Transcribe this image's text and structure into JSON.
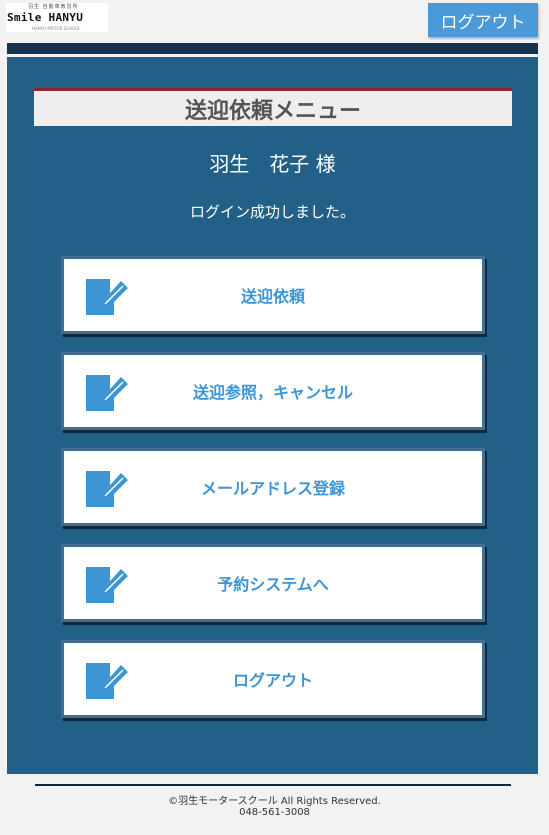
{
  "header": {
    "logo": {
      "top_text": "羽生 自動車教習所",
      "main_text": "Smile HANYU",
      "sub_text": "HANYU MOTOR SCHOOL"
    },
    "logout_label": "ログアウト"
  },
  "main": {
    "title": "送迎依頼メニュー",
    "user_name": "羽生　花子 様",
    "login_message": "ログイン成功しました。",
    "menu_items": [
      {
        "label": "送迎依頼",
        "icon": "edit-icon"
      },
      {
        "label": "送迎参照，キャンセル",
        "icon": "edit-icon"
      },
      {
        "label": "メールアドレス登録",
        "icon": "edit-icon"
      },
      {
        "label": "予約システムへ",
        "icon": "edit-icon"
      },
      {
        "label": "ログアウト",
        "icon": "edit-icon"
      }
    ]
  },
  "footer": {
    "copyright": "©羽生モータースクール All Rights Reserved.",
    "phone": "048-561-3008"
  },
  "colors": {
    "panel": "#226088",
    "band": "#16324c",
    "accent_button": "#4a9ad9",
    "menu_text": "#3d95d3",
    "title_border": "#8b2a2a"
  }
}
